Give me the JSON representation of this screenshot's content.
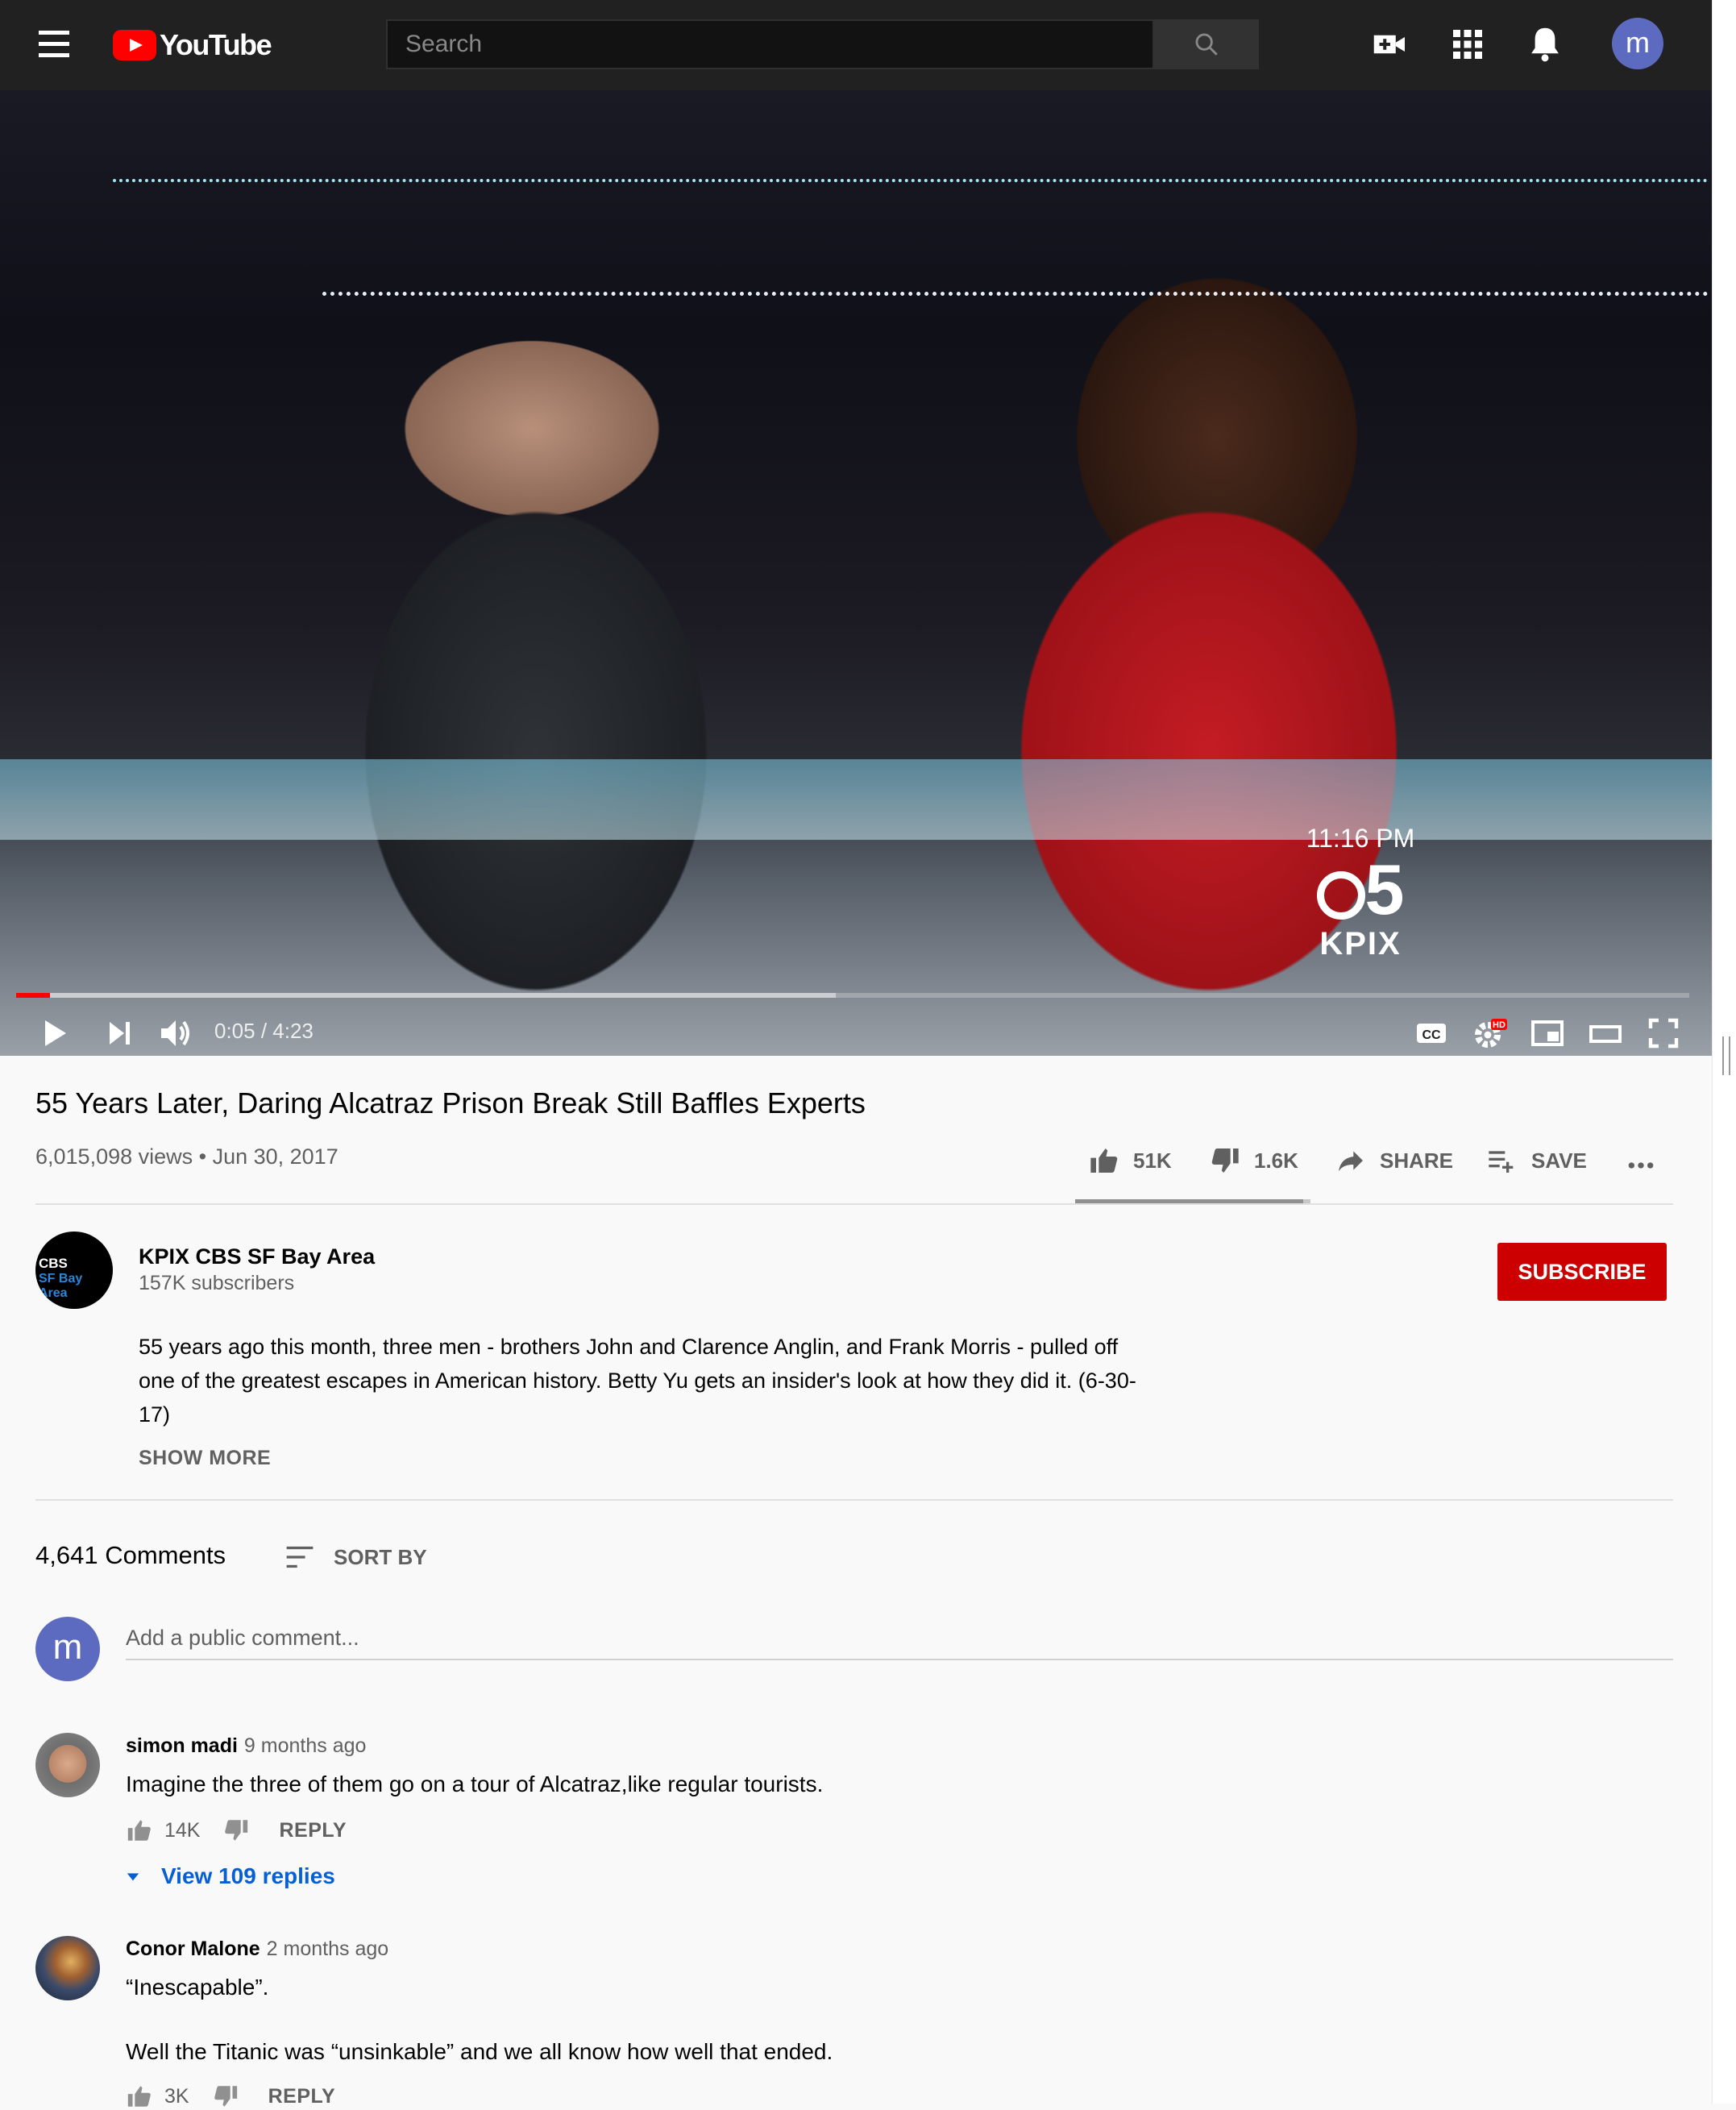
{
  "header": {
    "logo_text": "YouTube",
    "search_placeholder": "Search",
    "avatar_letter": "m"
  },
  "video": {
    "overlay_time": "11:16 PM",
    "overlay_channel_number": "5",
    "overlay_station": "KPIX",
    "current_time": "0:05",
    "duration": "4:23",
    "time_display": "0:05 / 4:23",
    "played_fraction": 0.02,
    "buffered_fraction": 0.49,
    "hd_badge": "HD",
    "cc_label": "CC"
  },
  "info": {
    "title": "55 Years Later, Daring Alcatraz Prison Break Still Baffles Experts",
    "views_date": "6,015,098 views • Jun 30, 2017",
    "likes": "51K",
    "dislikes": "1.6K",
    "share_label": "SHARE",
    "save_label": "SAVE",
    "like_ratio": 0.97
  },
  "channel": {
    "avatar_line1": "CBS",
    "avatar_line2": "SF Bay Area",
    "name": "KPIX CBS SF Bay Area",
    "subscribers": "157K subscribers",
    "subscribe_label": "SUBSCRIBE",
    "description": "55 years ago this month, three men - brothers John and Clarence Anglin, and Frank Morris - pulled off one of the greatest escapes in American history. Betty Yu gets an insider's look at how they did it. (6-30-17)",
    "show_more": "SHOW MORE"
  },
  "comments": {
    "count": "4,641 Comments",
    "sort_label": "SORT BY",
    "me_letter": "m",
    "add_placeholder": "Add a public comment...",
    "items": [
      {
        "author": "simon madi",
        "time": "9 months ago",
        "text": "Imagine the three of them go on a tour of Alcatraz,like regular tourists.",
        "likes": "14K",
        "reply_label": "REPLY",
        "view_replies": "View 109 replies"
      },
      {
        "author": "Conor Malone",
        "time": "2 months ago",
        "text_line1": "“Inescapable”.",
        "text_line2": "Well the Titanic was “unsinkable” and we all know how well that ended.",
        "likes": "3K",
        "reply_label": "REPLY"
      }
    ]
  },
  "colors": {
    "accent_red": "#ff0000",
    "subscribe_red": "#cc0000",
    "link_blue": "#065fd4",
    "header_bg": "#212121"
  },
  "icons": [
    "menu-icon",
    "youtube-play-icon",
    "search-icon",
    "create-video-icon",
    "apps-icon",
    "notifications-icon",
    "play-icon",
    "next-icon",
    "volume-icon",
    "captions-icon",
    "settings-icon",
    "miniplayer-icon",
    "theater-icon",
    "fullscreen-icon",
    "thumb-up-icon",
    "thumb-down-icon",
    "share-icon",
    "save-playlist-icon",
    "more-icon",
    "sort-icon",
    "caret-down-icon"
  ]
}
